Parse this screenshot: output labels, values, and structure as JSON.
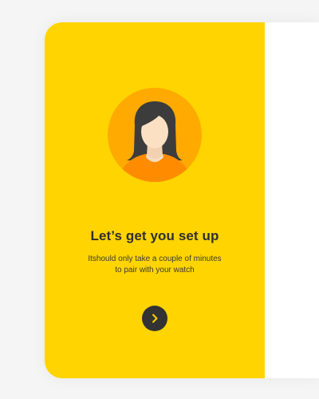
{
  "onboarding": {
    "title": "Let’s get you set up",
    "subtitle_line1": "Itshould only take a couple of minutes",
    "subtitle_line2": "to pair with your watch",
    "avatar_icon": "female-user-avatar-icon",
    "next_icon": "chevron-right-icon"
  },
  "colors": {
    "page_background": "#f5f5f5",
    "panel_yellow": "#ffd400",
    "avatar_circle": "#ffaa00",
    "button_dark": "#333333",
    "chevron": "#ffd400"
  }
}
